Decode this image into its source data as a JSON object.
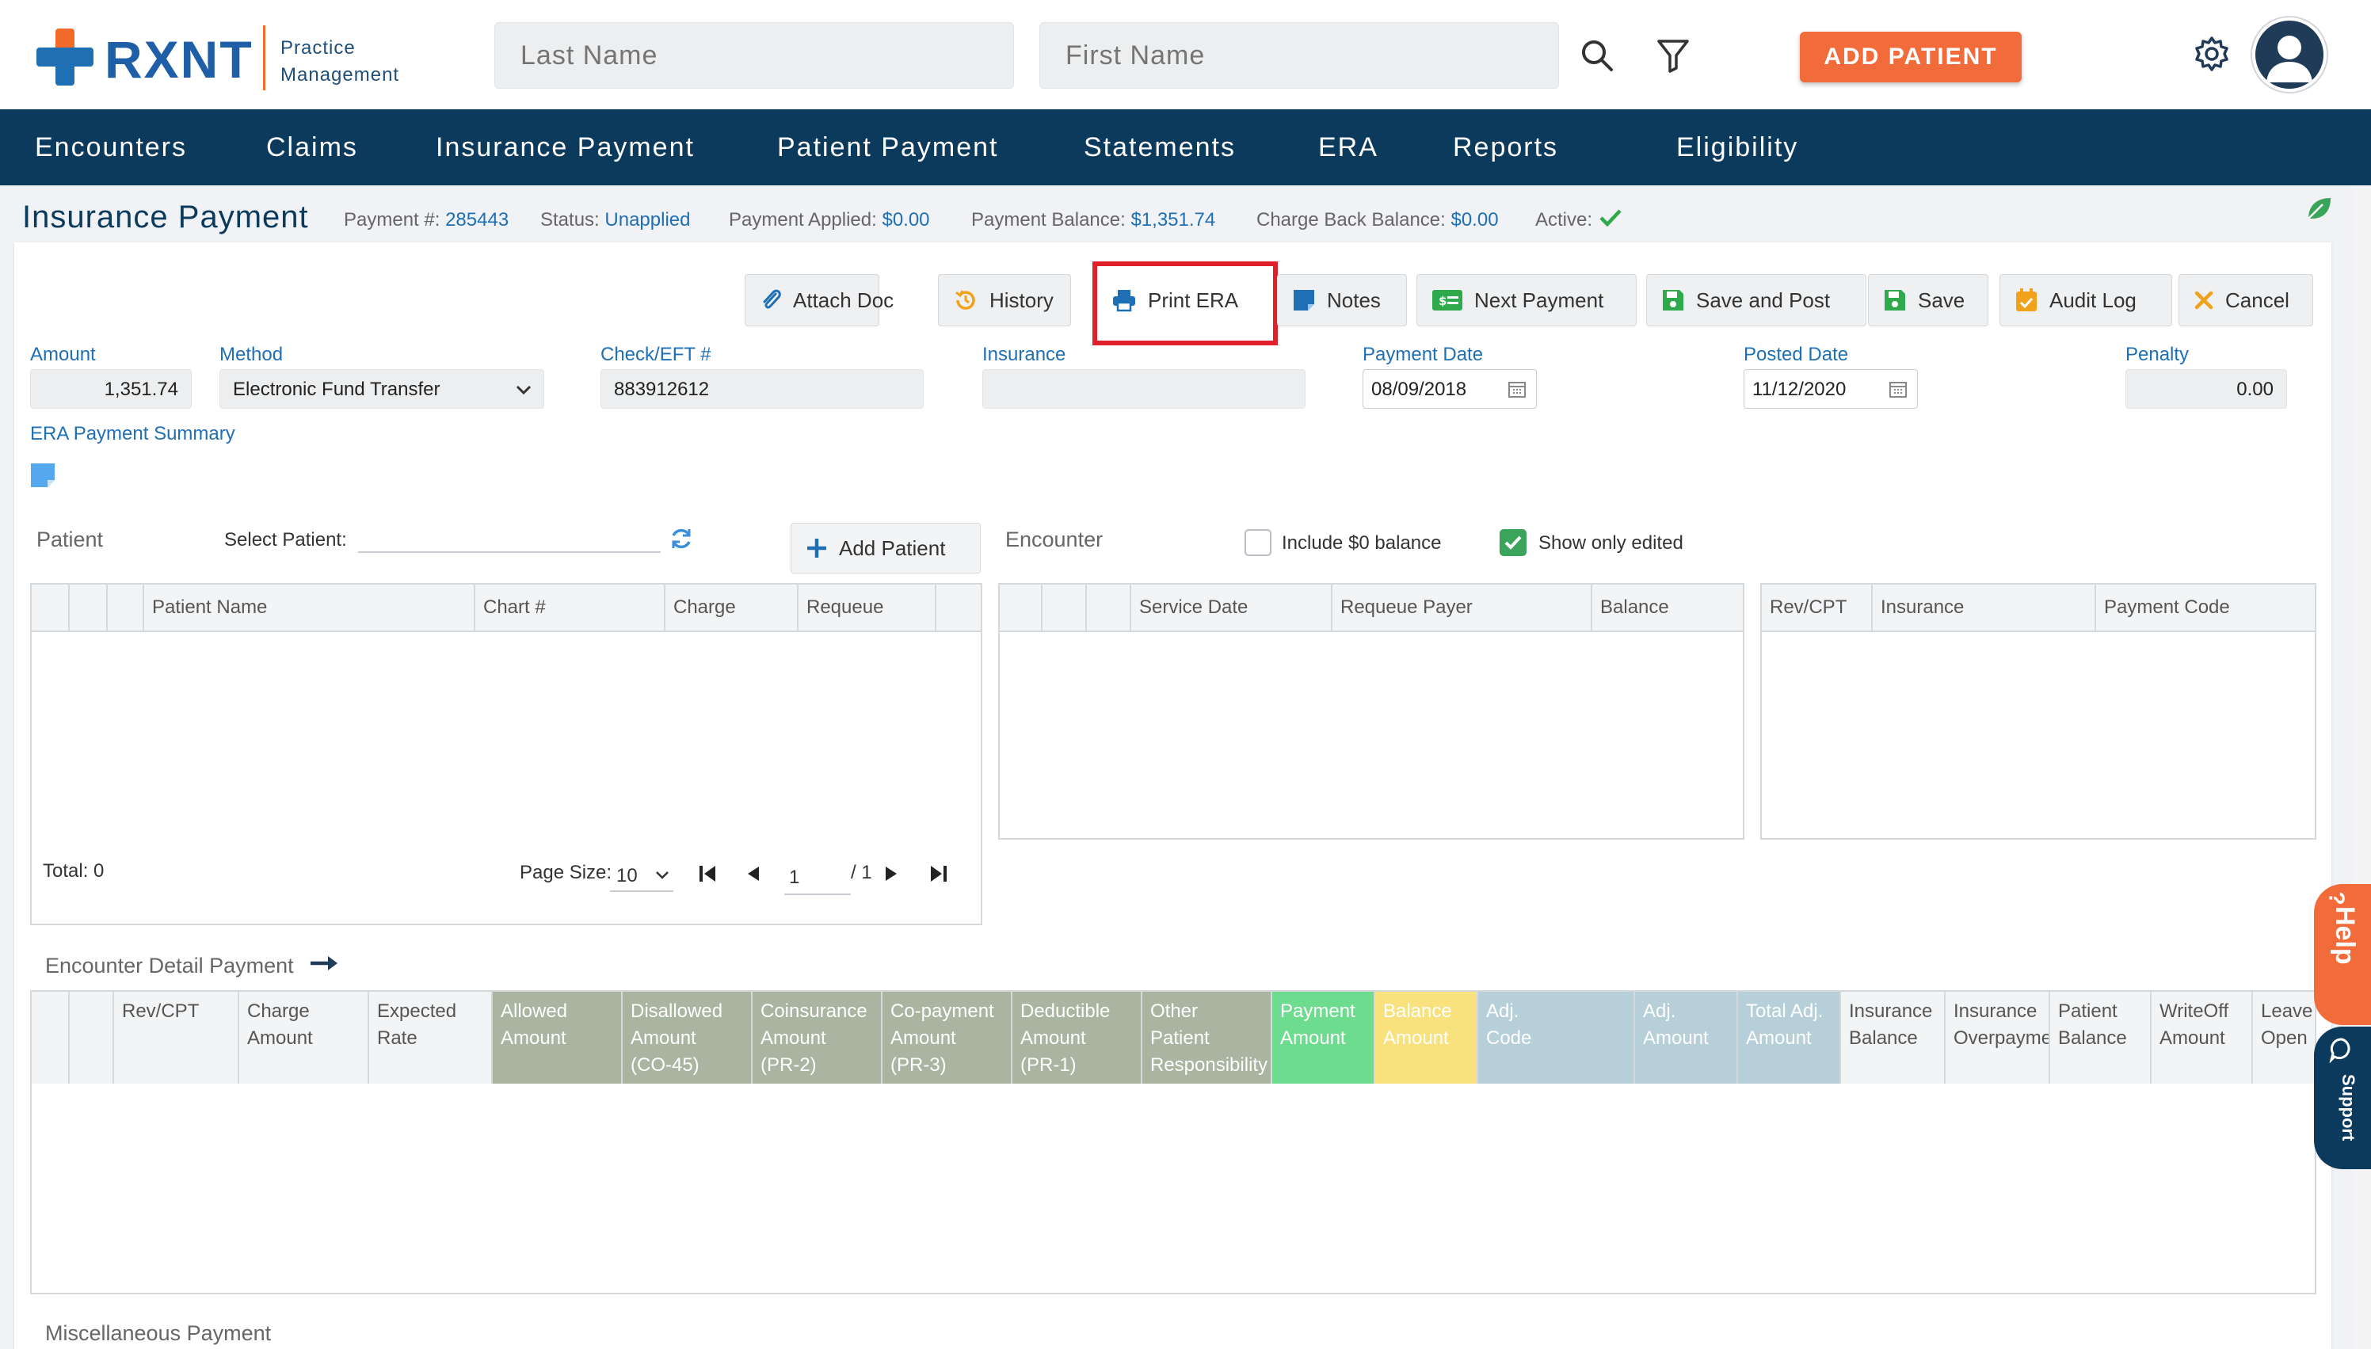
{
  "brand": {
    "name": "RXNT",
    "sub1": "Practice",
    "sub2": "Management"
  },
  "header": {
    "last_name_placeholder": "Last Name",
    "first_name_placeholder": "First Name",
    "add_patient_label": "ADD PATIENT"
  },
  "nav": {
    "items": [
      "Encounters",
      "Claims",
      "Insurance Payment",
      "Patient Payment",
      "Statements",
      "ERA",
      "Reports",
      "Eligibility"
    ]
  },
  "title_bar": {
    "title": "Insurance Payment",
    "payment_no_label": "Payment #:",
    "payment_no": "285443",
    "status_label": "Status:",
    "status": "Unapplied",
    "applied_label": "Payment Applied:",
    "applied": "$0.00",
    "balance_label": "Payment Balance:",
    "balance": "$1,351.74",
    "chargeback_label": "Charge Back Balance:",
    "chargeback": "$0.00",
    "active_label": "Active:"
  },
  "toolbar": {
    "attach_doc": "Attach Doc",
    "history": "History",
    "print_era": "Print ERA",
    "notes": "Notes",
    "next_payment": "Next Payment",
    "save_and_post": "Save and Post",
    "save": "Save",
    "audit_log": "Audit Log",
    "cancel": "Cancel"
  },
  "form": {
    "amount_label": "Amount",
    "amount": "1,351.74",
    "method_label": "Method",
    "method": "Electronic Fund Transfer",
    "check_label": "Check/EFT #",
    "check": "883912612",
    "insurance_label": "Insurance",
    "insurance": "",
    "payment_date_label": "Payment Date",
    "payment_date": "08/09/2018",
    "posted_date_label": "Posted Date",
    "posted_date": "11/12/2020",
    "penalty_label": "Penalty",
    "penalty": "0.00",
    "era_summary_label": "ERA Payment Summary"
  },
  "patient_section": {
    "label": "Patient",
    "select_label": "Select Patient:",
    "add_patient": "Add Patient",
    "columns": [
      "Patient Name",
      "Chart #",
      "Charge",
      "Requeue"
    ],
    "total": "Total: 0",
    "page_size_label": "Page Size:",
    "page_size": "10",
    "page": "1",
    "page_total": "/ 1"
  },
  "encounter_section": {
    "label": "Encounter",
    "include_zero": "Include $0 balance",
    "show_edited": "Show only edited",
    "columns": [
      "Service Date",
      "Requeue Payer",
      "Balance"
    ]
  },
  "detail_grid": {
    "columns": [
      "Rev/CPT",
      "Insurance",
      "Payment Code"
    ]
  },
  "encounter_detail": {
    "label": "Encounter Detail Payment",
    "columns": [
      "Rev/CPT",
      "Charge\nAmount",
      "Expected\nRate",
      "Allowed\nAmount",
      "Disallowed\nAmount\n(CO-45)",
      "Coinsurance\nAmount\n(PR-2)",
      "Co-payment\nAmount\n(PR-3)",
      "Deductible\nAmount\n(PR-1)",
      "Other\nPatient\nResponsibility",
      "Payment\nAmount",
      "Balance\nAmount",
      "Adj.\nCode",
      "Adj.\nAmount",
      "Total Adj.\nAmount",
      "Insurance\nBalance",
      "Insurance\nOverpayment",
      "Patient\nBalance",
      "WriteOff\nAmount",
      "Leave\nOpen"
    ],
    "column_colors": {
      "allowed_group": "#a9b5a0",
      "payment": "#6ddc8e",
      "balance": "#f9e27d",
      "adj_group": "#b6cfd9"
    }
  },
  "misc": {
    "label": "Miscellaneous Payment"
  },
  "side_tabs": {
    "help": "Help",
    "support": "Support"
  },
  "colors": {
    "accent": "#f26b3a",
    "nav": "#0b3a5c",
    "link": "#1f6fb5",
    "highlight": "#e0202a"
  }
}
